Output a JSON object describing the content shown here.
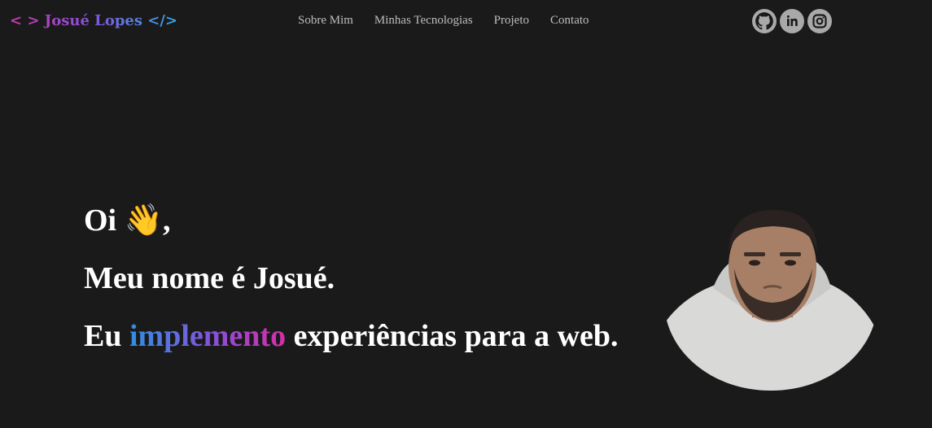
{
  "logo": {
    "text": "< > Josué Lopes </>"
  },
  "nav": [
    {
      "label": "Sobre Mim"
    },
    {
      "label": "Minhas Tecnologias"
    },
    {
      "label": "Projeto"
    },
    {
      "label": "Contato"
    }
  ],
  "social": [
    {
      "icon": "github-icon"
    },
    {
      "icon": "linkedin-icon"
    },
    {
      "icon": "instagram-icon"
    }
  ],
  "hero": {
    "greeting": "Oi",
    "wave": "👋",
    "comma": ",",
    "line2": "Meu nome é Josué.",
    "line3_prefix": "Eu",
    "line3_highlight": "implemento",
    "line3_suffix": "experiências para a web."
  },
  "colors": {
    "background": "#1a1a1b",
    "gradient_start": "#2f8fe3",
    "gradient_mid": "#8a4fd8",
    "gradient_end": "#d42ea6",
    "nav_text": "#bdbdbd",
    "icon_bg": "#a9a9a9"
  }
}
